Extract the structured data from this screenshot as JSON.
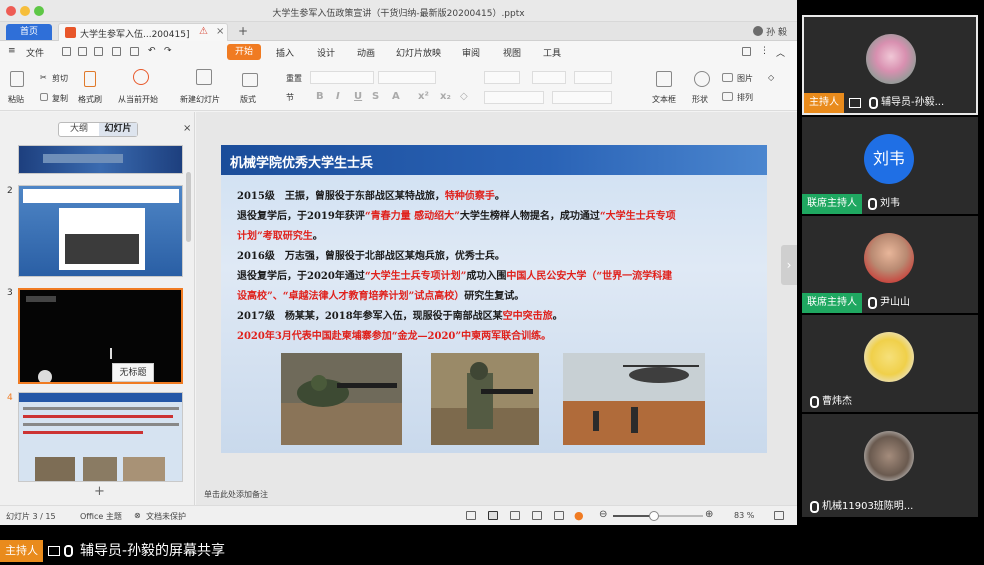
{
  "window": {
    "title": "大学生参军入伍政策宣讲（干货归纳-最新版20200415）.pptx"
  },
  "tabs": {
    "home": "首页",
    "doc": "大学生参军入伍...200415]",
    "plus": "+",
    "user": "孙 毅"
  },
  "menu": {
    "file": "文件",
    "start": "开始",
    "items": [
      "插入",
      "设计",
      "动画",
      "幻灯片放映",
      "审阅",
      "视图",
      "工具"
    ]
  },
  "ribbon": {
    "paste": "粘贴",
    "cut": "剪切",
    "copy": "复制",
    "format_painter": "格式刷",
    "from_current": "从当前开始",
    "new_slide": "新建幻灯片",
    "layout": "版式",
    "reset": "重置",
    "section": "节",
    "textbox": "文本框",
    "shapes": "形状",
    "picture": "图片",
    "arrange": "排列"
  },
  "left_panel": {
    "outline_tab": "大纲",
    "slides_tab": "幻灯片",
    "close": "×",
    "numbers": [
      "2",
      "3",
      "4"
    ],
    "tooltip": "无标题",
    "add": "+"
  },
  "slide": {
    "title": "机械学院优秀大学生士兵",
    "lines": [
      {
        "parts": [
          {
            "t": "2015级　王振，曾服役于东部战区某特战旅，",
            "red": false
          },
          {
            "t": "特种侦察手",
            "red": true
          },
          {
            "t": "。",
            "red": false
          }
        ]
      },
      {
        "parts": [
          {
            "t": "退役复学后，于2019年获评",
            "red": false
          },
          {
            "t": "“青春力量 感动绍大”",
            "red": true
          },
          {
            "t": "大学生榜样人物提名，成功通过",
            "red": false
          },
          {
            "t": "“大学生士兵专项",
            "red": true
          }
        ]
      },
      {
        "parts": [
          {
            "t": "计划”考取研究生",
            "red": true
          },
          {
            "t": "。",
            "red": false
          }
        ]
      },
      {
        "parts": [
          {
            "t": "2016级　万志强，曾服役于北部战区某炮兵旅，优秀士兵。",
            "red": false
          }
        ]
      },
      {
        "parts": [
          {
            "t": "退役复学后，于2020年通过",
            "red": false
          },
          {
            "t": "“大学生士兵专项计划”",
            "red": true
          },
          {
            "t": "成功入围",
            "red": false
          },
          {
            "t": "中国人民公安大学（“世界一流学科建",
            "red": true
          }
        ]
      },
      {
        "parts": [
          {
            "t": "设高校”、“卓越法律人才教育培养计划”试点高校）",
            "red": true
          },
          {
            "t": "研究生复试。",
            "red": false
          }
        ]
      },
      {
        "parts": [
          {
            "t": "2017级　杨某某，2018年参军入伍，现服役于南部战区某",
            "red": false
          },
          {
            "t": "空中突击旅",
            "red": true
          },
          {
            "t": "。",
            "red": false
          }
        ]
      },
      {
        "parts": [
          {
            "t": "2020年3月代表中国赴柬埔寨参加“金龙—2020”中柬两军联合训练。",
            "red": true
          }
        ]
      }
    ],
    "notes_placeholder": "单击此处添加备注"
  },
  "status": {
    "slide_counter": "幻灯片 3 / 15",
    "theme": "Office 主题",
    "protect": "文档未保护",
    "zoom": "83 %",
    "zoom_fraction": 0.45
  },
  "participants": [
    {
      "role": "主持人",
      "role_type": "host",
      "name": "辅导员-孙毅...",
      "active": true,
      "sharing": true
    },
    {
      "role": "联席主持人",
      "role_type": "cohost",
      "name": "刘韦",
      "avatar_text": "刘韦",
      "avatar_color": "#1f6fe5"
    },
    {
      "role": "联席主持人",
      "role_type": "cohost",
      "name": "尹山山"
    },
    {
      "role": "",
      "role_type": "none",
      "name": "曹炜杰"
    },
    {
      "role": "",
      "role_type": "none",
      "name": "机械11903班陈明..."
    }
  ],
  "share_bar": {
    "role": "主持人",
    "text": "辅导员-孙毅的屏幕共享"
  },
  "colors": {
    "host": "#e98b1c",
    "cohost": "#1fa861",
    "accent": "#f07b22",
    "wps_blue": "#2f6fd8"
  }
}
